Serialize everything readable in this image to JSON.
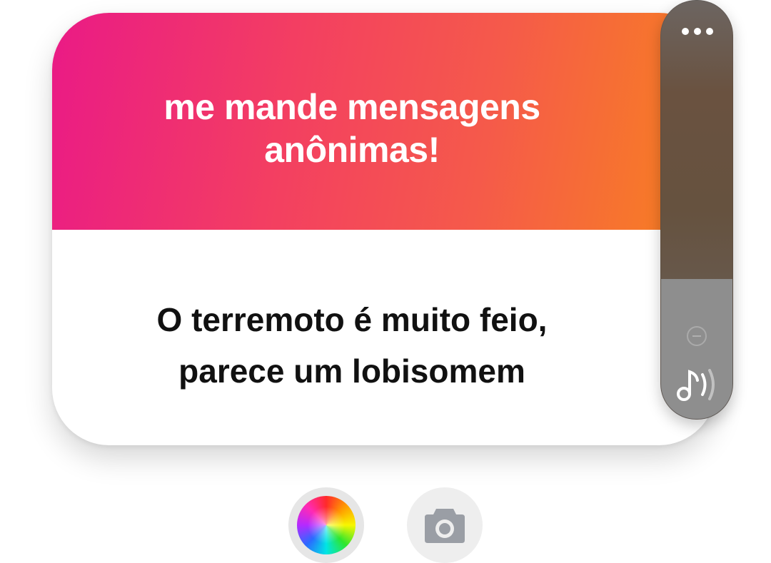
{
  "sticker": {
    "prompt_line1": "me mande mensagens",
    "prompt_line2": "anônimas!",
    "answer_line1": "O terremoto é muito feio,",
    "answer_line2": "parece um lobisomem",
    "gradient_colors": [
      "#ea1a86",
      "#f33e62",
      "#f55a4a",
      "#f8841d"
    ]
  },
  "side_panel": {
    "more_icon": "more-dots-icon",
    "minus_icon": "minus-circle-icon",
    "sound_icon": "music-sound-icon"
  },
  "tools": {
    "color_icon": "color-wheel-icon",
    "camera_icon": "camera-icon"
  }
}
